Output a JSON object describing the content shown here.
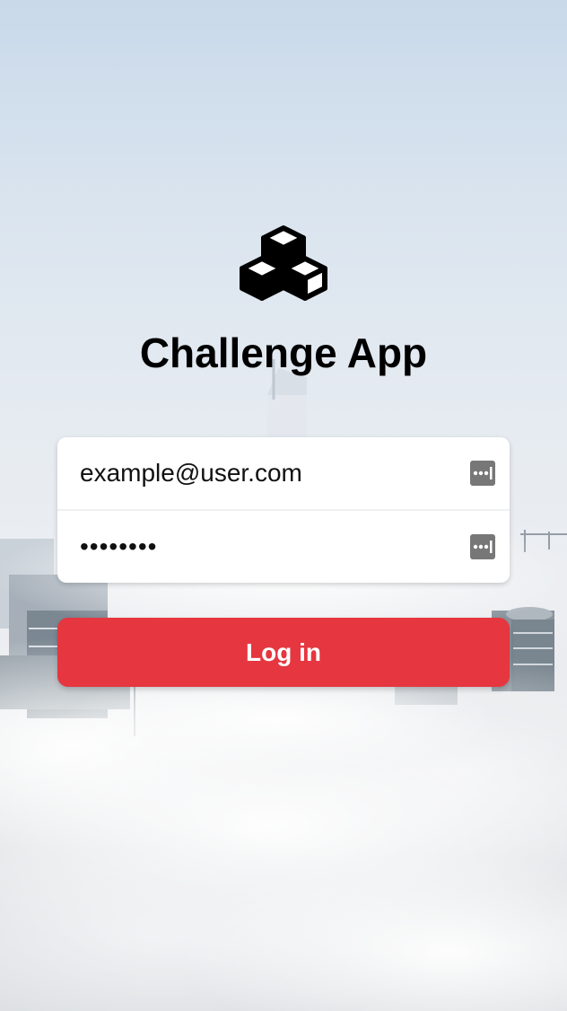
{
  "app": {
    "title": "Challenge App",
    "logo_icon": "cubes-icon"
  },
  "form": {
    "email": {
      "value": "example@user.com",
      "icon": "password-manager-icon"
    },
    "password": {
      "value": "password",
      "icon": "password-manager-icon"
    },
    "login_label": "Log in"
  },
  "colors": {
    "primary_button": "#e6363f",
    "card_background": "#ffffff",
    "title_text": "#000000"
  }
}
